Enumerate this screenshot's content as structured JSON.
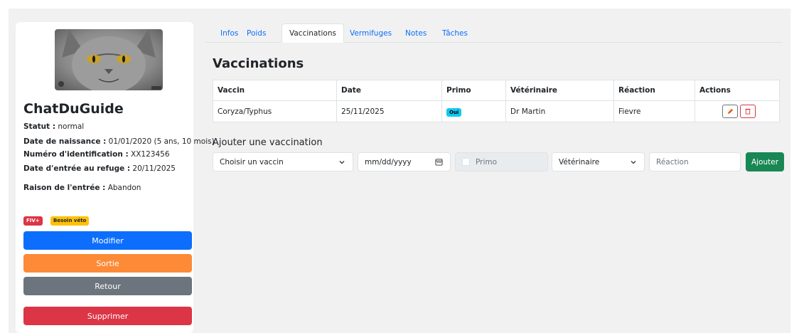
{
  "animal": {
    "name": "ChatDuGuide",
    "photo_alt": "cat-photo",
    "details": [
      {
        "label": "Statut :",
        "value": " normal"
      },
      {
        "label": "Date de naissance :",
        "value": " 01/01/2020 (5 ans, 10 mois)"
      },
      {
        "label": "Numéro d'identification :",
        "value": " XX123456"
      },
      {
        "label": "Date d'entrée au refuge :",
        "value": " 20/11/2025"
      },
      {
        "label": "Raison de l'entrée :",
        "value": " Abandon"
      }
    ],
    "badges": [
      {
        "text": "FIV+",
        "color": "#dc3545"
      },
      {
        "text": "Besoin véto",
        "color": "#ffc107"
      }
    ]
  },
  "actions": {
    "modifier": "Modifier",
    "sortie": "Sortie",
    "retour": "Retour",
    "supprimer": "Supprimer"
  },
  "colors": {
    "primary": "#0d6efd",
    "orange": "#fd8a37",
    "secondary": "#6c757d",
    "danger": "#dc3545",
    "success": "#198754",
    "info": "#0dcaf0"
  },
  "tabs": [
    "Infos",
    "Poids",
    "Vaccinations",
    "Vermifuges",
    "Notes",
    "Tâches"
  ],
  "active_tab": "Vaccinations",
  "vaccinations": {
    "title": "Vaccinations",
    "columns": [
      "Vaccin",
      "Date",
      "Primo",
      "Vétérinaire",
      "Réaction",
      "Actions"
    ],
    "rows": [
      {
        "vaccin": "Coryza/Typhus",
        "date": "25/11/2025",
        "primo": "Oui",
        "veterinaire": "Dr Martin",
        "reaction": "Fievre",
        "icons": [
          "pencil-icon",
          "trash-icon"
        ]
      }
    ]
  },
  "add_form": {
    "title": "Ajouter une vaccination",
    "vaccin_select": "Choisir un vaccin",
    "date_placeholder": "mm/dd/yyyy",
    "primo_label": "Primo",
    "veterinaire_select": "Vétérinaire",
    "reaction_placeholder": "Réaction",
    "submit": "Ajouter"
  }
}
